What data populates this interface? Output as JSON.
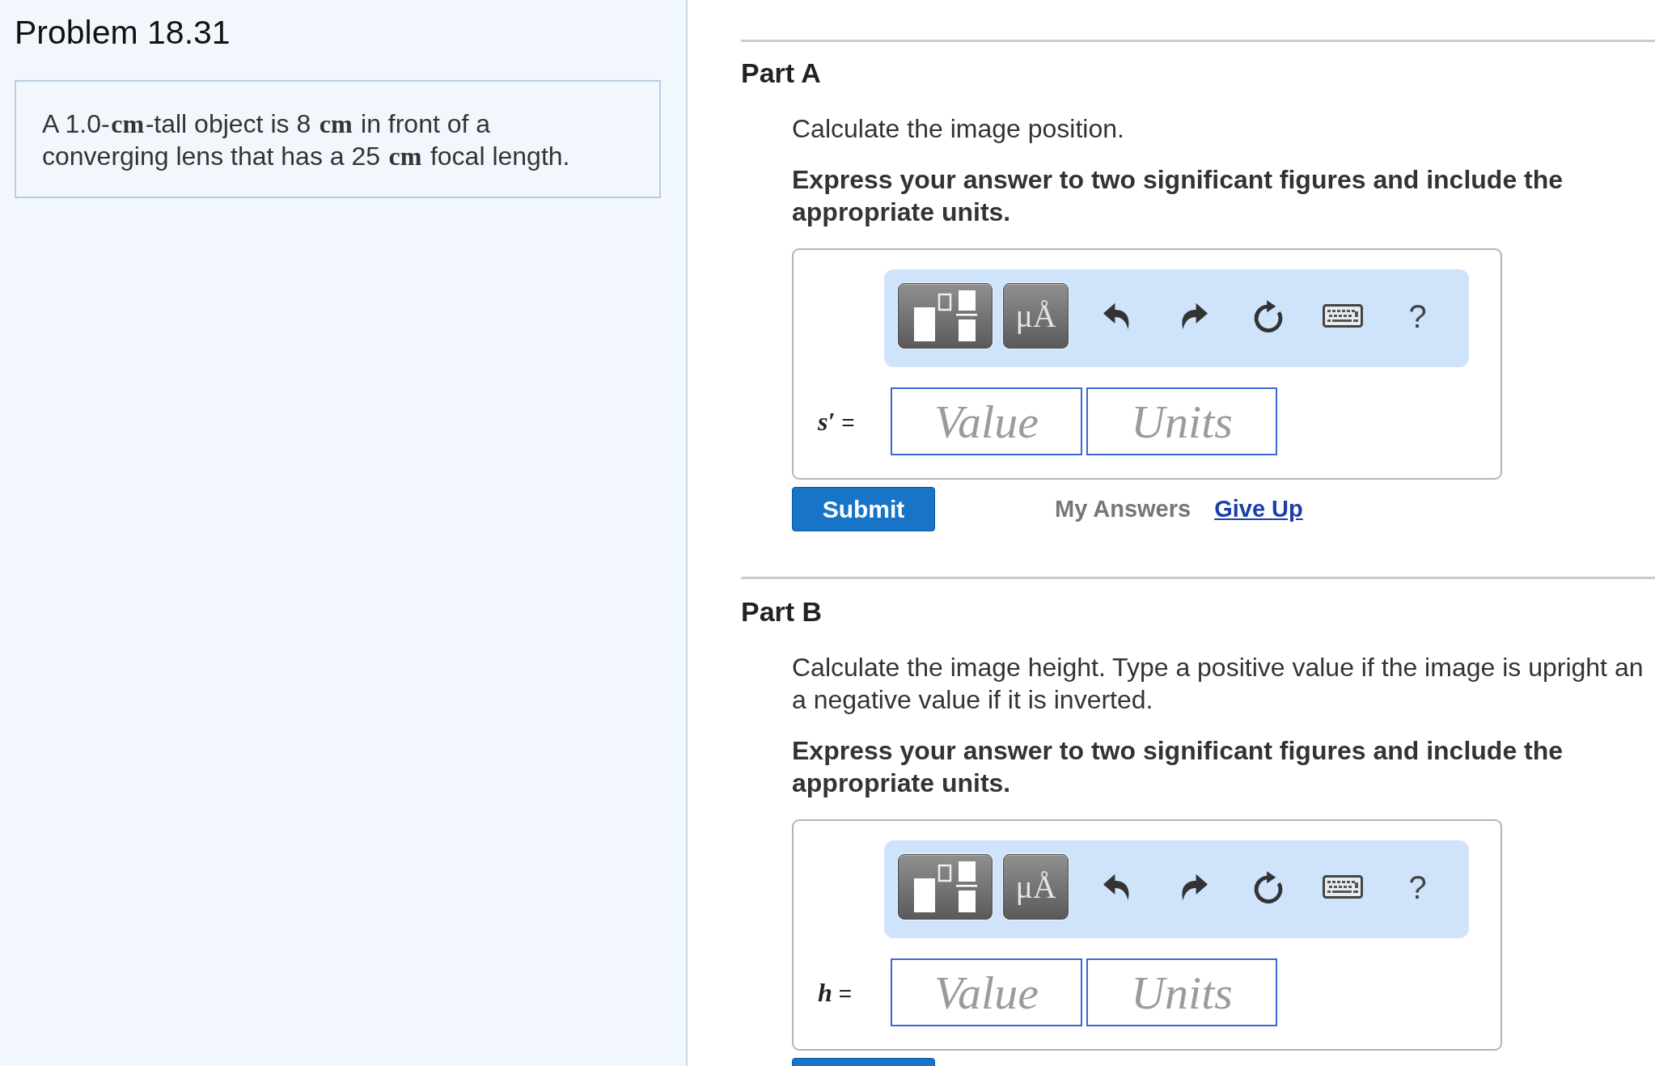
{
  "problem": {
    "title": "Problem 18.31",
    "statement": "A 1.0-**cm**-tall object is 8 **cm** in front of a converging lens that has a 25 **cm** focal length."
  },
  "parts": [
    {
      "title": "Part A",
      "description": [
        "Calculate the image position."
      ],
      "instruction": "Express your answer to two significant figures and include the appropriate units.",
      "toolbar": [
        {
          "kind": "templates"
        },
        {
          "kind": "units",
          "label": "μÅ"
        },
        {
          "kind": "undo"
        },
        {
          "kind": "redo"
        },
        {
          "kind": "reset"
        },
        {
          "kind": "keyboard"
        },
        {
          "kind": "help",
          "label": "?"
        }
      ],
      "answer": {
        "label": "*s′* =",
        "fields": [
          {
            "placeholder": "Value"
          },
          {
            "placeholder": "Units"
          }
        ]
      },
      "submit_label": "Submit",
      "links": [
        {
          "label": "My Answers",
          "disabled": true
        },
        {
          "label": "Give Up",
          "disabled": false
        }
      ]
    },
    {
      "title": "Part B",
      "description": [
        "Calculate the image height. Type a positive value if the image is upright an",
        "a negative value if it is inverted."
      ],
      "instruction": "Express your answer to two significant figures and include the appropriate units.",
      "toolbar": [
        {
          "kind": "templates"
        },
        {
          "kind": "units",
          "label": "μÅ"
        },
        {
          "kind": "undo"
        },
        {
          "kind": "redo"
        },
        {
          "kind": "reset"
        },
        {
          "kind": "keyboard"
        },
        {
          "kind": "help",
          "label": "?"
        }
      ],
      "answer": {
        "label": "*h* =",
        "fields": [
          {
            "placeholder": "Value"
          },
          {
            "placeholder": "Units"
          }
        ]
      }
    }
  ]
}
